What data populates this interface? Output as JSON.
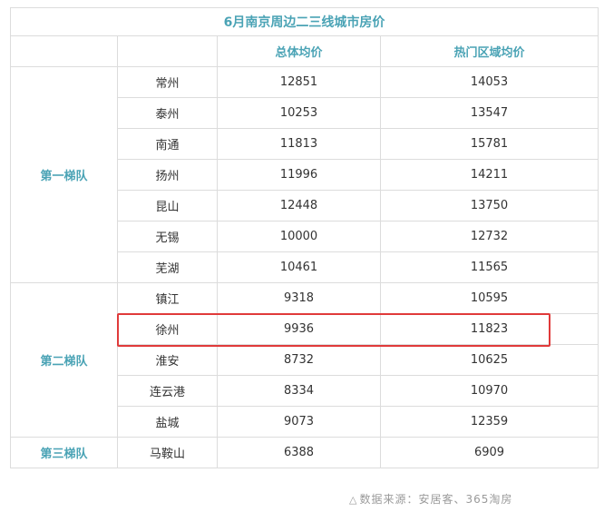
{
  "table": {
    "title": "6月南京周边二三线城市房价",
    "headers": [
      "",
      "",
      "总体均价",
      "热门区域均价"
    ],
    "tiers": [
      {
        "name": "第一梯队",
        "rows": [
          {
            "city": "常州",
            "avg": "12851",
            "hot": "14053"
          },
          {
            "city": "泰州",
            "avg": "10253",
            "hot": "13547"
          },
          {
            "city": "南通",
            "avg": "11813",
            "hot": "15781"
          },
          {
            "city": "扬州",
            "avg": "11996",
            "hot": "14211"
          },
          {
            "city": "昆山",
            "avg": "12448",
            "hot": "13750"
          },
          {
            "city": "无锡",
            "avg": "10000",
            "hot": "12732"
          },
          {
            "city": "芜湖",
            "avg": "10461",
            "hot": "11565"
          }
        ]
      },
      {
        "name": "第二梯队",
        "rows": [
          {
            "city": "镇江",
            "avg": "9318",
            "hot": "10595"
          },
          {
            "city": "徐州",
            "avg": "9936",
            "hot": "11823"
          },
          {
            "city": "淮安",
            "avg": "8732",
            "hot": "10625"
          },
          {
            "city": "连云港",
            "avg": "8334",
            "hot": "10970"
          },
          {
            "city": "盐城",
            "avg": "9073",
            "hot": "12359"
          }
        ]
      },
      {
        "name": "第三梯队",
        "rows": [
          {
            "city": "马鞍山",
            "avg": "6388",
            "hot": "6909"
          }
        ]
      }
    ]
  },
  "highlight": {
    "tier": 1,
    "row": 1,
    "color": "#e03a3a"
  },
  "source": {
    "icon": "triangle-icon",
    "icon_glyph": "△",
    "text": "数据来源：安居客、365淘房"
  },
  "colors": {
    "accent": "#4aa3b5",
    "border": "#dcdcdc",
    "text": "#333333",
    "muted": "#9a9a9a"
  }
}
